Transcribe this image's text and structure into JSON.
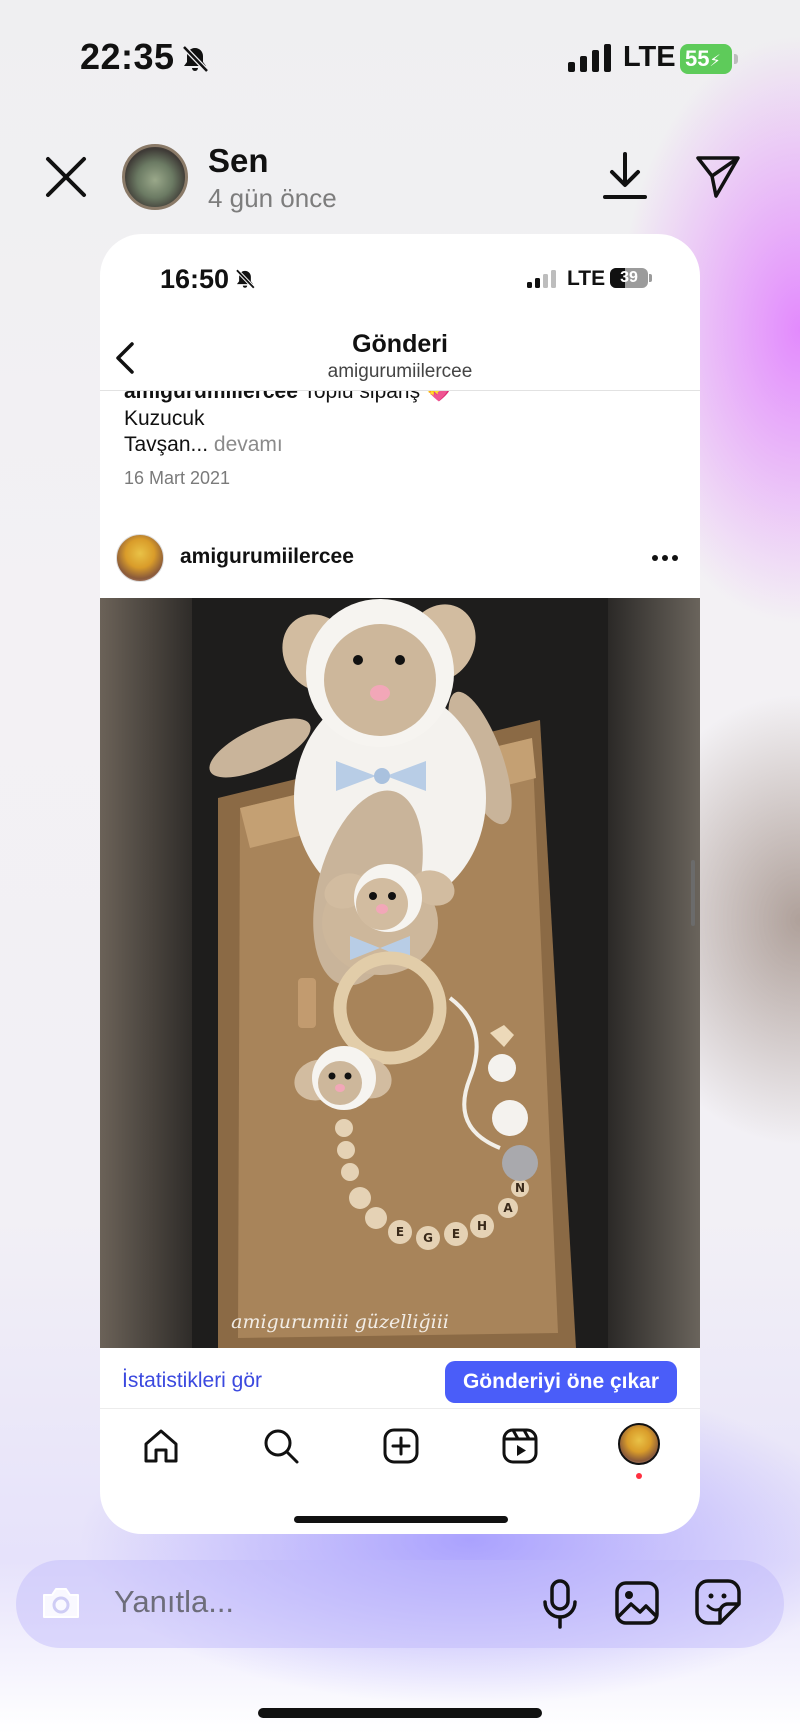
{
  "status_bar": {
    "time": "22:35",
    "network": "LTE",
    "battery": "55"
  },
  "story_header": {
    "name": "Sen",
    "time_ago": "4 gün önce"
  },
  "inner_status_bar": {
    "time": "16:50",
    "network": "LTE",
    "battery": "39",
    "battery_level": 0.39
  },
  "inner_nav": {
    "title": "Gönderi",
    "subtitle": "amigurumiilercee"
  },
  "caption": {
    "username": "amigurumiilercee",
    "text": "Toplu sipariş 💝",
    "line2": "Kuzucuk",
    "line3": "Tavşan...",
    "more": "devamı",
    "date": "16 Mart 2021"
  },
  "post": {
    "username": "amigurumiilercee",
    "watermark": "amigurumiii güzelliğiii",
    "name_beads": [
      "E",
      "G",
      "E",
      "H",
      "A",
      "N"
    ]
  },
  "actions": {
    "stats": "İstatistikleri gör",
    "boost": "Gönderiyi öne çıkar"
  },
  "tab_bar": [
    "home-icon",
    "search-icon",
    "create-icon",
    "reels-icon",
    "profile-avatar"
  ],
  "reply": {
    "placeholder": "Yanıtla..."
  }
}
